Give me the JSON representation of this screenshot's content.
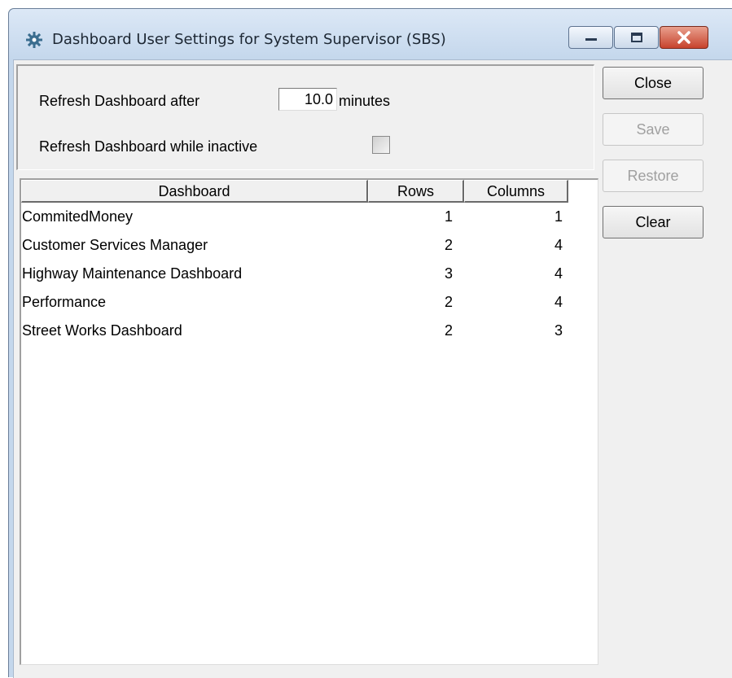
{
  "window": {
    "title": "Dashboard User Settings for System Supervisor (SBS)",
    "icon": "gear-icon",
    "caption_buttons": [
      "minimize-icon",
      "maximize-icon",
      "close-icon"
    ]
  },
  "settings": {
    "refresh_label": "Refresh Dashboard after",
    "refresh_value": "10.0",
    "refresh_unit": "minutes",
    "inactive_label": "Refresh Dashboard while inactive",
    "inactive_checked": false
  },
  "buttons": {
    "close": "Close",
    "save": "Save",
    "restore": "Restore",
    "clear": "Clear"
  },
  "table": {
    "headers": {
      "dashboard": "Dashboard",
      "rows": "Rows",
      "columns": "Columns"
    },
    "rows": [
      {
        "name": "CommitedMoney",
        "rows": "1",
        "columns": "1"
      },
      {
        "name": "Customer Services Manager",
        "rows": "2",
        "columns": "4"
      },
      {
        "name": "Highway Maintenance Dashboard",
        "rows": "3",
        "columns": "4"
      },
      {
        "name": "Performance",
        "rows": "2",
        "columns": "4"
      },
      {
        "name": "Street Works Dashboard",
        "rows": "2",
        "columns": "3"
      }
    ]
  },
  "colors": {
    "window_frame": "#c4d7ec",
    "close_button": "#c7432d",
    "dialog_background": "#f0f0f0"
  }
}
